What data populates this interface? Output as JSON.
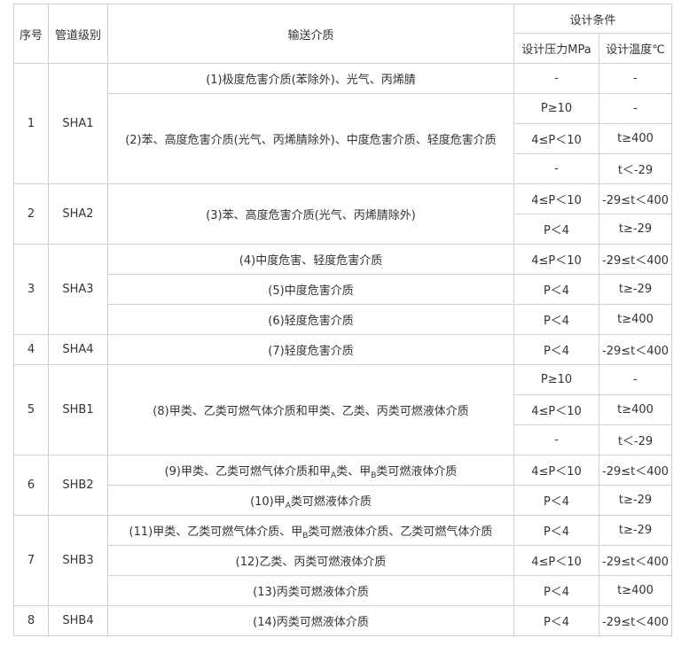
{
  "headers": {
    "no": "序号",
    "grade": "管道级别",
    "medium": "输送介质",
    "design_conditions": "设计条件",
    "pressure": "设计压力MPa",
    "temperature": "设计温度℃"
  },
  "rows": [
    {
      "no": "1",
      "grade": "SHA1",
      "medium_a": "(1)极度危害介质(苯除外)、光气、丙烯腈",
      "medium_b": "(2)苯、高度危害介质(光气、丙烯腈除外)、中度危害介质、轻度危害介质",
      "cond": [
        {
          "p": "-",
          "t": "-"
        },
        {
          "p": "P≥10",
          "t": "-"
        },
        {
          "p": "4≤P＜10",
          "t": "t≥400"
        },
        {
          "p": "-",
          "t": "t＜-29"
        }
      ]
    },
    {
      "no": "2",
      "grade": "SHA2",
      "medium": "(3)苯、高度危害介质(光气、丙烯腈除外)",
      "cond": [
        {
          "p": "4≤P＜10",
          "t": "-29≤t＜400"
        },
        {
          "p": "P＜4",
          "t": "t≥-29"
        }
      ]
    },
    {
      "no": "3",
      "grade": "SHA3",
      "mediums": [
        "(4)中度危害、轻度危害介质",
        "(5)中度危害介质",
        "(6)轻度危害介质"
      ],
      "cond": [
        {
          "p": "4≤P＜10",
          "t": "-29≤t＜400"
        },
        {
          "p": "P＜4",
          "t": "t≥-29"
        },
        {
          "p": "P＜4",
          "t": "t≥400"
        }
      ]
    },
    {
      "no": "4",
      "grade": "SHA4",
      "medium": "(7)轻度危害介质",
      "cond": [
        {
          "p": "P＜4",
          "t": "-29≤t＜400"
        }
      ]
    },
    {
      "no": "5",
      "grade": "SHB1",
      "medium": "(8)甲类、乙类可燃气体介质和甲类、乙类、丙类可燃液体介质",
      "cond": [
        {
          "p": "P≥10",
          "t": "-"
        },
        {
          "p": "4≤P＜10",
          "t": "t≥400"
        },
        {
          "p": "-",
          "t": "t＜-29"
        }
      ]
    },
    {
      "no": "6",
      "grade": "SHB2",
      "m9": {
        "pre": "(9)甲类、乙类可燃气体介质和甲",
        "sub1": "A",
        "mid": "类、甲",
        "sub2": "B",
        "post": "类可燃液体介质"
      },
      "m10": {
        "pre": "(10)甲",
        "sub": "A",
        "post": "类可燃液体介质"
      },
      "cond": [
        {
          "p": "4≤P＜10",
          "t": "-29≤t＜400"
        },
        {
          "p": "P＜4",
          "t": "t≥-29"
        }
      ]
    },
    {
      "no": "7",
      "grade": "SHB3",
      "m11": {
        "pre": "(11)甲类、乙类可燃气体介质、甲",
        "sub": "B",
        "post": "类可燃液体介质、乙类可燃气体介质"
      },
      "m12": "(12)乙类、丙类可燃液体介质",
      "m13": "(13)丙类可燃液体介质",
      "cond": [
        {
          "p": "P＜4",
          "t": "t≥-29"
        },
        {
          "p": "4≤P＜10",
          "t": "-29≤t＜400"
        },
        {
          "p": "P＜4",
          "t": "t≥400"
        }
      ]
    },
    {
      "no": "8",
      "grade": "SHB4",
      "medium": "(14)丙类可燃液体介质",
      "cond": [
        {
          "p": "P＜4",
          "t": "-29≤t＜400"
        }
      ]
    }
  ]
}
